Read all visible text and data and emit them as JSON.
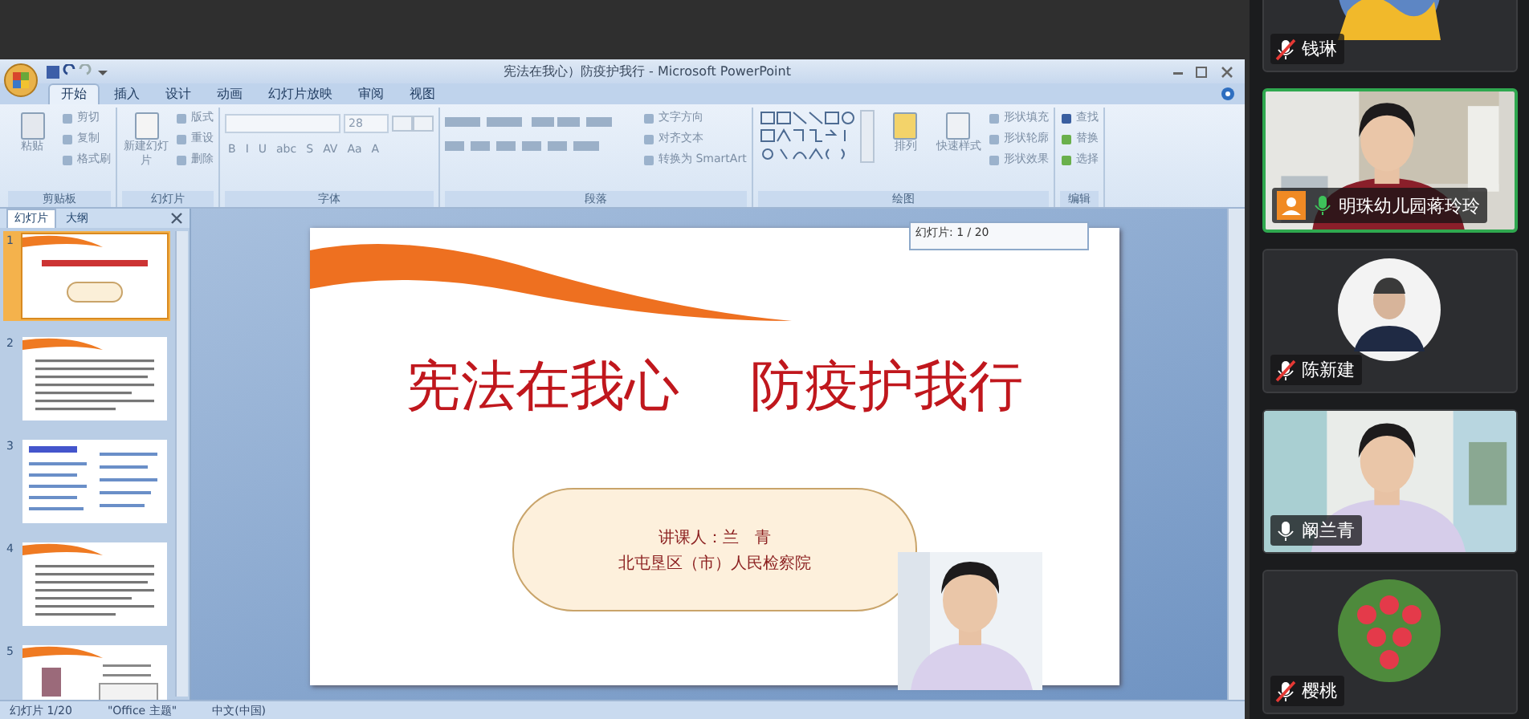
{
  "window": {
    "title": "宪法在我心）防疫护我行 - Microsoft PowerPoint"
  },
  "ribbon": {
    "tabs": [
      {
        "label": "开始",
        "selected": true
      },
      {
        "label": "插入",
        "selected": false
      },
      {
        "label": "设计",
        "selected": false
      },
      {
        "label": "动画",
        "selected": false
      },
      {
        "label": "幻灯片放映",
        "selected": false
      },
      {
        "label": "审阅",
        "selected": false
      },
      {
        "label": "视图",
        "selected": false
      }
    ],
    "groups": [
      {
        "label": "剪贴板",
        "kind": "clipboard",
        "big": "粘贴",
        "small": [
          "剪切",
          "复制",
          "格式刷"
        ]
      },
      {
        "label": "幻灯片",
        "kind": "slides",
        "big": "新建幻灯片",
        "small": [
          "版式",
          "重设",
          "删除"
        ]
      },
      {
        "label": "字体",
        "kind": "font",
        "font_size": "28",
        "buttons": [
          "B",
          "I",
          "U",
          "abc",
          "S",
          "AV",
          "Aa",
          "A"
        ]
      },
      {
        "label": "段落",
        "kind": "paragraph",
        "small": [
          "文字方向",
          "对齐文本",
          "转换为 SmartArt"
        ]
      },
      {
        "label": "绘图",
        "kind": "drawing",
        "big": "排列",
        "big2": "快速样式",
        "small": [
          "形状填充",
          "形状轮廓",
          "形状效果"
        ]
      },
      {
        "label": "编辑",
        "kind": "editing",
        "small": [
          "查找",
          "替换",
          "选择"
        ]
      }
    ]
  },
  "slide_panel": {
    "tabs": [
      {
        "label": "幻灯片",
        "selected": true
      },
      {
        "label": "大纲",
        "selected": false
      }
    ],
    "thumbnails": [
      {
        "number": "1",
        "kind": "title",
        "selected": true
      },
      {
        "number": "2",
        "kind": "text",
        "selected": false
      },
      {
        "number": "3",
        "kind": "list",
        "selected": false
      },
      {
        "number": "4",
        "kind": "text",
        "selected": false
      },
      {
        "number": "5",
        "selected": false
      }
    ]
  },
  "slide": {
    "title": [
      "宪法在我心",
      "防疫护我行"
    ],
    "speaker": "讲课人：兰　青",
    "organization": "北屯垦区（市）人民检察院",
    "indicator": "幻灯片: 1 / 20"
  },
  "status_bar": [
    "幻灯片 1/20",
    "\"Office 主题\"",
    "中文(中国)"
  ],
  "participants": [
    {
      "name": "钱琳",
      "muted": true,
      "speaking": false,
      "host": false,
      "camera_on": false
    },
    {
      "name": "明珠幼儿园蒋玲玲",
      "muted": false,
      "speaking": true,
      "host": true,
      "camera_on": true
    },
    {
      "name": "陈新建",
      "muted": true,
      "speaking": false,
      "host": false,
      "camera_on": false
    },
    {
      "name": "阚兰青",
      "muted": false,
      "speaking": false,
      "host": false,
      "camera_on": true
    },
    {
      "name": "樱桃",
      "muted": true,
      "speaking": false,
      "host": false,
      "camera_on": false
    }
  ]
}
